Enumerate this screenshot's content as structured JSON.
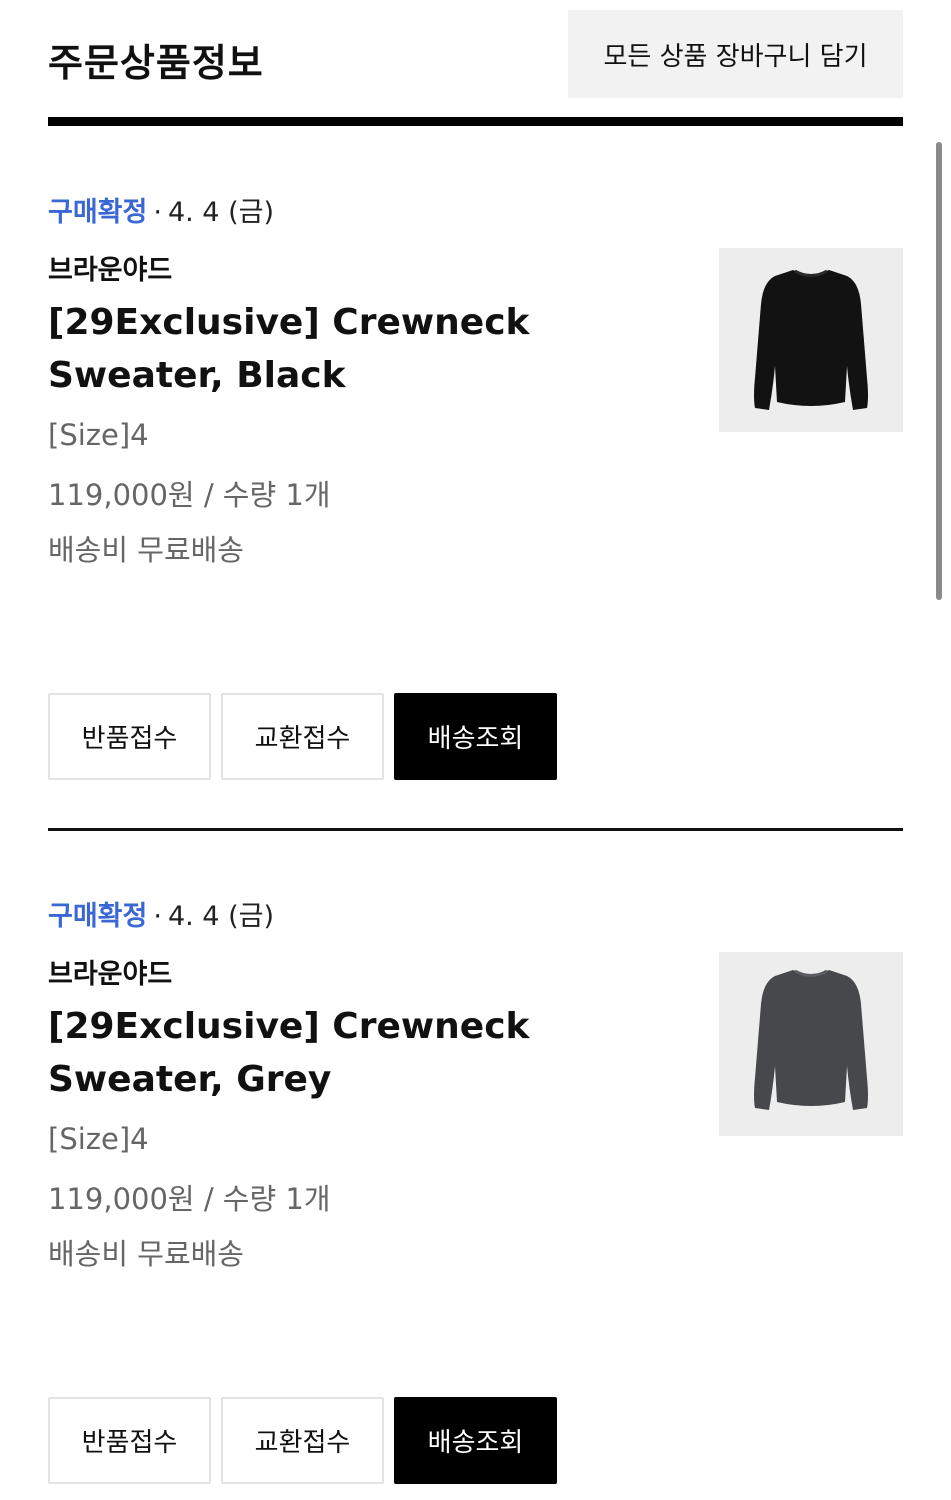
{
  "header": {
    "title": "주문상품정보",
    "cart_all_label": "모든 상품 장바구니 담기"
  },
  "items": [
    {
      "status": "구매확정",
      "separator": "·",
      "date": "4. 4 (금)",
      "brand": "브라운야드",
      "name": "[29Exclusive] Crewneck Sweater, Black",
      "option": "[Size]4",
      "price_qty": "119,000원 / 수량 1개",
      "shipping": "배송비 무료배송",
      "image_icon": "black-sweater-icon",
      "sweater_color": "#121212",
      "buttons": {
        "return": "반품접수",
        "exchange": "교환접수",
        "track": "배송조회"
      }
    },
    {
      "status": "구매확정",
      "separator": "·",
      "date": "4. 4 (금)",
      "brand": "브라운야드",
      "name": "[29Exclusive] Crewneck Sweater, Grey",
      "option": "[Size]4",
      "price_qty": "119,000원 / 수량 1개",
      "shipping": "배송비 무료배송",
      "image_icon": "grey-sweater-icon",
      "sweater_color": "#46484b",
      "buttons": {
        "return": "반품접수",
        "exchange": "교환접수",
        "track": "배송조회"
      }
    }
  ],
  "colors": {
    "status_blue": "#3a67d6",
    "track_button_bg": "#000000",
    "cart_button_bg": "#f2f2f2"
  }
}
